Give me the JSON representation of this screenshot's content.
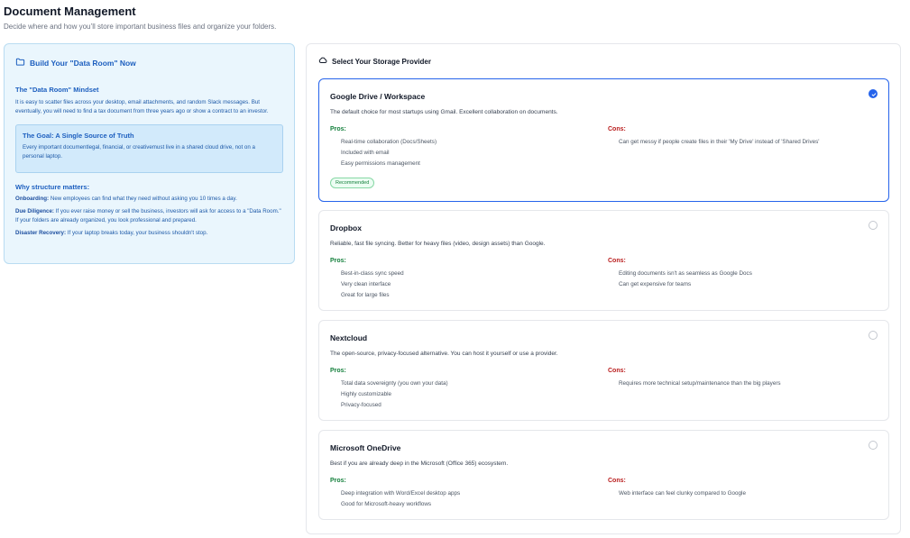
{
  "page": {
    "title": "Document Management",
    "subtitle": "Decide where and how you’ll store important business files and organize your folders."
  },
  "info": {
    "header": "Build Your \"Data Room\" Now",
    "mindset_title": "The \"Data Room\" Mindset",
    "mindset_text": "It is easy to scatter files across your desktop, email attachments, and random Slack messages. But eventually, you will need to find a tax document from three years ago or show a contract to an investor.",
    "goal_title": "The Goal: A Single Source of Truth",
    "goal_text": "Every important documentlegal, financial, or creativemust live in a shared cloud drive, not on a personal laptop.",
    "why_title": "Why structure matters:",
    "why_items": [
      {
        "label": "Onboarding:",
        "text": " New employees can find what they need without asking you 10 times a day."
      },
      {
        "label": "Due Diligence:",
        "text": " If you ever raise money or sell the business, investors will ask for access to a \"Data Room.\" If your folders are already organized, you look professional and prepared."
      },
      {
        "label": "Disaster Recovery:",
        "text": " If your laptop breaks today, your business shouldn't stop."
      }
    ]
  },
  "panel": {
    "header": "Select Your Storage Provider",
    "pros_label": "Pros:",
    "cons_label": "Cons:",
    "providers": [
      {
        "name": "Google Drive / Workspace",
        "desc": "The default choice for most startups using Gmail. Excellent collaboration on documents.",
        "pros": [
          "Real-time collaboration (Docs/Sheets)",
          "Included with email",
          "Easy permissions management"
        ],
        "cons": [
          "Can get messy if people create files in their 'My Drive' instead of 'Shared Drives'"
        ],
        "badge": "Recommended",
        "selected": true
      },
      {
        "name": "Dropbox",
        "desc": "Reliable, fast file syncing. Better for heavy files (video, design assets) than Google.",
        "pros": [
          "Best-in-class sync speed",
          "Very clean interface",
          "Great for large files"
        ],
        "cons": [
          "Editing documents isn't as seamless as Google Docs",
          "Can get expensive for teams"
        ],
        "selected": false
      },
      {
        "name": "Nextcloud",
        "desc": "The open-source, privacy-focused alternative. You can host it yourself or use a provider.",
        "pros": [
          "Total data sovereignty (you own your data)",
          "Highly customizable",
          "Privacy-focused"
        ],
        "cons": [
          "Requires more technical setup/maintenance than the big players"
        ],
        "selected": false
      },
      {
        "name": "Microsoft OneDrive",
        "desc": "Best if you are already deep in the Microsoft (Office 365) ecosystem.",
        "pros": [
          "Deep integration with Word/Excel desktop apps",
          "Good for Microsoft-heavy workflows"
        ],
        "cons": [
          "Web interface can feel clunky compared to Google"
        ],
        "selected": false
      }
    ]
  },
  "colors": {
    "accent": "#2563eb",
    "pros": "#15803d",
    "cons": "#b91c1c",
    "info_bg": "#eaf6fd"
  },
  "icons": {
    "info_header": "folder-icon",
    "panel_header": "cloud-icon",
    "selected_radio": "check-icon"
  }
}
